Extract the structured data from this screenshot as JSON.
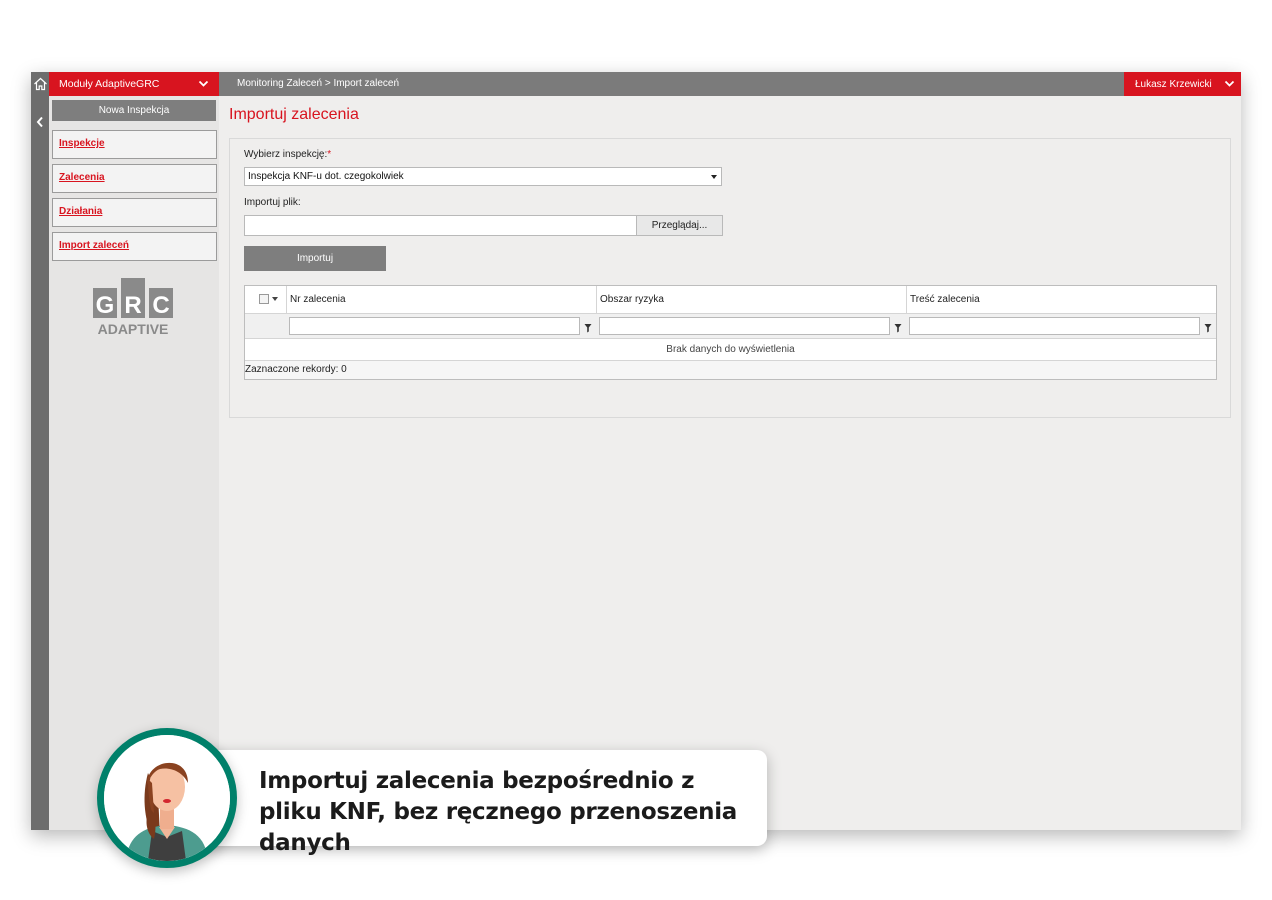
{
  "topbar": {
    "modules_label": "Moduły AdaptiveGRC",
    "breadcrumb": "Monitoring Zaleceń > Import zaleceń",
    "user_name": "Łukasz Krzewicki"
  },
  "sidebar": {
    "new_inspection_label": "Nowa Inspekcja",
    "items": [
      {
        "label": "Inspekcje"
      },
      {
        "label": "Zalecenia"
      },
      {
        "label": "Działania"
      },
      {
        "label": "Import zaleceń"
      }
    ],
    "logo": {
      "letters": [
        "G",
        "R",
        "C"
      ],
      "word": "ADAPTIVE"
    }
  },
  "main": {
    "title": "Importuj zalecenia",
    "select_label": "Wybierz inspekcję:",
    "required_mark": "*",
    "select_value": "Inspekcja KNF-u dot. czegokolwiek",
    "file_label": "Importuj plik:",
    "browse_label": "Przeglądaj...",
    "import_label": "Importuj"
  },
  "grid": {
    "columns": [
      "Nr zalecenia",
      "Obszar ryzyka",
      "Treść zalecenia"
    ],
    "empty_text": "Brak danych do wyświetlenia",
    "selected_records": "Zaznaczone rekordy: 0"
  },
  "callout": {
    "text": "Importuj zalecenia bezpośrednio z pliku KNF, bez ręcznego przenoszenia danych"
  },
  "colors": {
    "accent_red": "#d8141f",
    "topbar_gray": "#7b7b7b",
    "avatar_ring": "#00806a"
  },
  "icons": [
    "home-icon",
    "chevron-left-icon",
    "chevron-down-icon",
    "dropdown-arrow-icon",
    "filter-icon",
    "checkbox-icon"
  ]
}
